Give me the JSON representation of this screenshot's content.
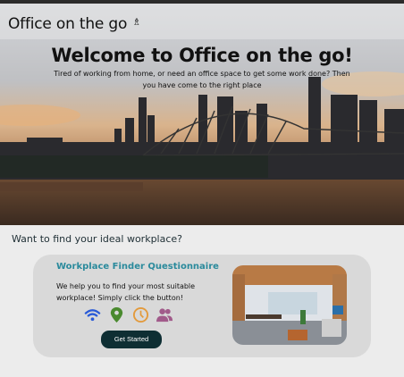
{
  "header": {
    "brand": "Office on the go",
    "brand_icon": "office-chair-icon"
  },
  "hero": {
    "title": "Welcome to Office on the go!",
    "subtitle": "Tired of working from home, or need an office space to get some work done? Then you have come to the right place"
  },
  "section": {
    "heading": "Want to find your ideal workplace?"
  },
  "card": {
    "title": "Workplace Finder Questionnaire",
    "description": "We help you to find your most suitable workplace! Simply click the button!",
    "icons": [
      {
        "name": "wifi-icon",
        "color": "#2a5bd7"
      },
      {
        "name": "location-pin-icon",
        "color": "#4a8a2e"
      },
      {
        "name": "clock-icon",
        "color": "#e39a3c"
      },
      {
        "name": "users-icon",
        "color": "#a15a8a"
      }
    ],
    "button": "Get Started"
  }
}
